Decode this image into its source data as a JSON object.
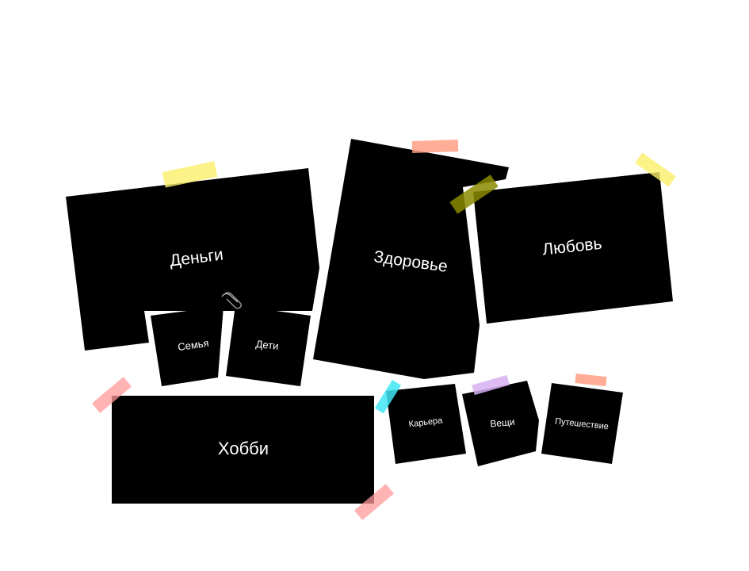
{
  "board": {
    "cards": {
      "money": "Деньги",
      "health": "Здоровье",
      "love": "Любовь",
      "family": "Семья",
      "kids": "Дети",
      "hobby": "Хобби",
      "career": "Карьера",
      "things": "Вещи",
      "travel": "Путешествие"
    }
  },
  "colors": {
    "card": "#000000",
    "background": "#ffffff",
    "tape_yellow": "#fbf06a",
    "tape_orange": "#ff9f85",
    "tape_pink": "#ff9a9a",
    "tape_cyan": "#3ee6f5",
    "tape_olive": "#8a8a00",
    "tape_lilac": "#d6b0f0"
  }
}
